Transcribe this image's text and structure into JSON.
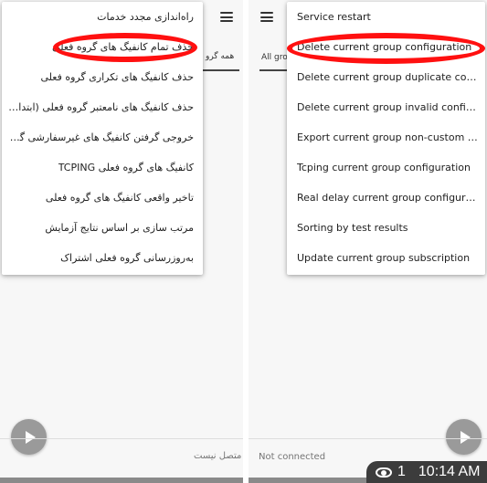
{
  "left": {
    "tab_label": "همه گرو",
    "menu_items": [
      "راه‌اندازی مجدد خدمات",
      "حذف تمام کانفیگ های گروه فعلی",
      "حذف کانفیگ های تکراری گروه فعلی",
      "حذف کانفیگ های نامعتبر گروه فعلی (ابتدا آزمای...",
      "خروجی گرفتن کانفیگ های غیرسفارشی گروه فعل...",
      "کانفیگ های گروه فعلی TCPING",
      "تاخیر واقعی کانفیگ های گروه فعلی",
      "مرتب سازی بر اساس نتایج آزمایش",
      "به‌روزرسانی گروه فعلی اشتراک"
    ],
    "status": "متصل نیست"
  },
  "right": {
    "tab_label": "All gro",
    "menu_items": [
      "Service restart",
      "Delete current group configuration",
      "Delete current group duplicate configur...",
      "Delete current group invalid configurati...",
      "Export current group non-custom confi...",
      "Tcping current group configuration",
      "Real delay current group configuration",
      "Sorting by test results",
      "Update current group subscription"
    ],
    "status": "Not connected"
  },
  "overlay": {
    "view_count": "1",
    "time": "10:14 AM"
  },
  "colors": {
    "highlight": "#ff1010",
    "fab": "#9a9a9a"
  }
}
